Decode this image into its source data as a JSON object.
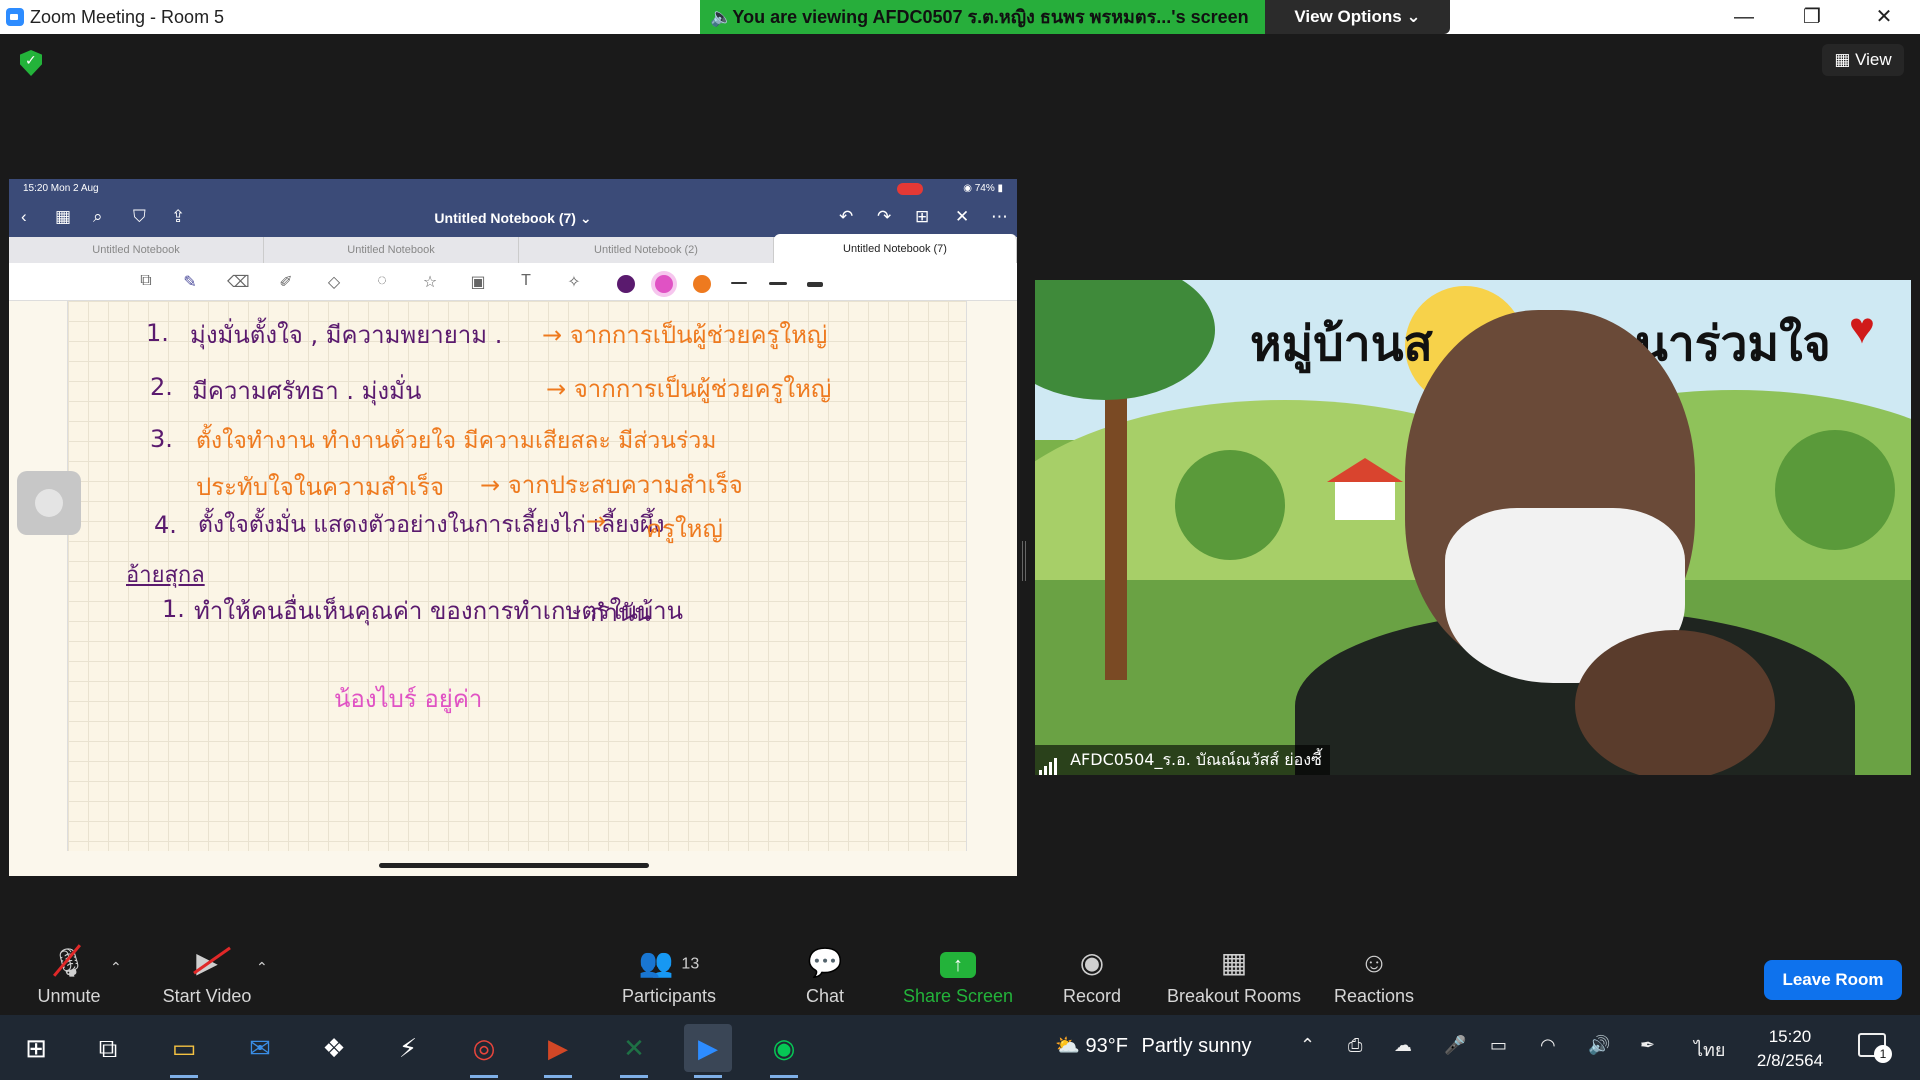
{
  "window": {
    "title": "Zoom Meeting - Room 5",
    "share_banner": "🔈You are viewing AFDC0507 ร.ต.หญิง ธนพร พรหมตร...'s screen",
    "view_options": "View Options ⌄",
    "controls": {
      "minimize": "—",
      "restore": "❐",
      "close": "✕"
    }
  },
  "meeting": {
    "view_label": "▦ View"
  },
  "ipad": {
    "status_time": "15:20   Mon 2 Aug",
    "status_battery": "◉ 74% ▮",
    "notebook_title": "Untitled Notebook (7) ⌄",
    "tabs": [
      {
        "label": "Untitled Notebook"
      },
      {
        "label": "Untitled Notebook"
      },
      {
        "label": "Untitled Notebook (2)"
      },
      {
        "label": "Untitled Notebook (7)"
      }
    ],
    "colors": {
      "purple": "#5a1a6e",
      "pink": "#e052c4",
      "orange": "#ee7a1f"
    },
    "notes": {
      "line1_num": "1.",
      "line1_text": "มุ่งมั่นตั้งใจ , มีความพยายาม .",
      "line1_note": "→ จากการเป็นผู้ช่วยครูใหญ่",
      "line2_num": "2.",
      "line2_text": "มีความศรัทธา . มุ่งมั่น",
      "line2_note": "→ จากการเป็นผู้ช่วยครูใหญ่",
      "line3_num": "3.",
      "line3_text": "ตั้งใจทำงาน  ทำงานด้วยใจ  มีความเสียสละ  มีส่วนร่วม",
      "line3b_text": "ประทับใจในความสำเร็จ",
      "line3b_note": "→ จากประสบความสำเร็จ",
      "line4_num": "4.",
      "line4_text": "ตั้งใจตั้งมั่น  แสดงตัวอย่างในการเลี้ยงไก่  เลี้ยงผึ้ง",
      "line4_arrow": "→",
      "line4_note": "ครูใหญ่",
      "section_title": "อ้ายสุกล",
      "s1_num": "1.",
      "s1_text": "ทำให้คนอื่นเห็นคุณค่า ของการทำเกษตรในบ้าน",
      "s1_note": "กำนัน",
      "pink_note": "น้องไบร์ อยู่ค่า"
    }
  },
  "video": {
    "bg_title_left": "หมู่บ้านส",
    "bg_title_right": "นาร่วมใจ",
    "participant_name": "AFDC0504_ร.อ. บัณณ์ณวัสส์ ย่องซี้"
  },
  "toolbar": {
    "unmute": "Unmute",
    "start_video": "Start Video",
    "participants": "Participants",
    "participants_count": "13",
    "chat": "Chat",
    "share_screen": "Share Screen",
    "record": "Record",
    "breakout_rooms": "Breakout Rooms",
    "reactions": "Reactions",
    "leave_room": "Leave Room",
    "share_color": "#23b33a",
    "leave_color": "#0e72ed"
  },
  "taskbar": {
    "weather_temp": "93°F",
    "weather_desc": "Partly sunny",
    "language": "ไทย",
    "time": "15:20",
    "date": "2/8/2564",
    "notification_count": "1"
  }
}
